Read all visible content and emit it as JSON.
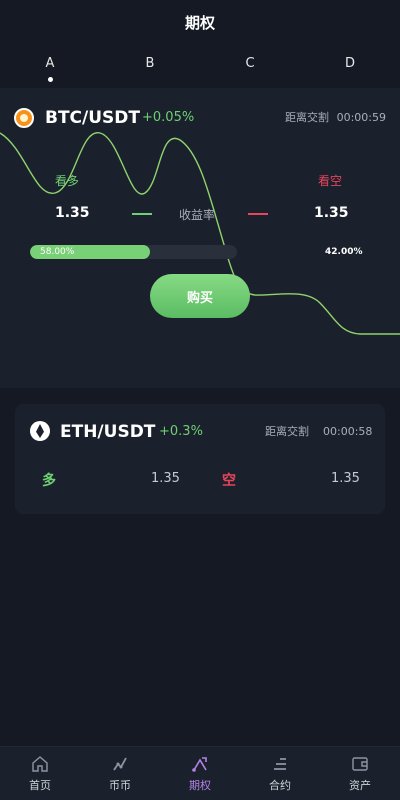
{
  "header": {
    "title": "期权"
  },
  "tabs": [
    {
      "label": "A",
      "active": true
    },
    {
      "label": "B",
      "active": false
    },
    {
      "label": "C",
      "active": false
    },
    {
      "label": "D",
      "active": false
    }
  ],
  "main_panel": {
    "pair": "BTC/USDT",
    "change": "+0.05%",
    "countdown_label": "距离交割",
    "countdown": "00:00:59",
    "long_label": "看多",
    "short_label": "看空",
    "long_value": "1.35",
    "short_value": "1.35",
    "yield_label": "收益率",
    "long_percent_text": "58.00%",
    "short_percent_text": "42.00%",
    "long_ratio": 0.58,
    "buy_label": "购买",
    "line_color": "#8fd36c"
  },
  "second_card": {
    "pair": "ETH/USDT",
    "change": "+0.3%",
    "countdown_label": "距离交割",
    "countdown": "00:00:58",
    "long_label": "多",
    "long_value": "1.35",
    "short_label": "空",
    "short_value": "1.35"
  },
  "bottom_nav": [
    {
      "label": "首页",
      "icon": "home-icon",
      "active": false
    },
    {
      "label": "币币",
      "icon": "trade-icon",
      "active": false
    },
    {
      "label": "期权",
      "icon": "option-icon",
      "active": true
    },
    {
      "label": "合约",
      "icon": "contract-icon",
      "active": false
    },
    {
      "label": "资产",
      "icon": "wallet-icon",
      "active": false
    }
  ],
  "colors": {
    "background": "#141923",
    "panel": "#1b212c",
    "green": "#6fcf73",
    "red": "#e8445a",
    "accent_active": "#b583e6"
  }
}
